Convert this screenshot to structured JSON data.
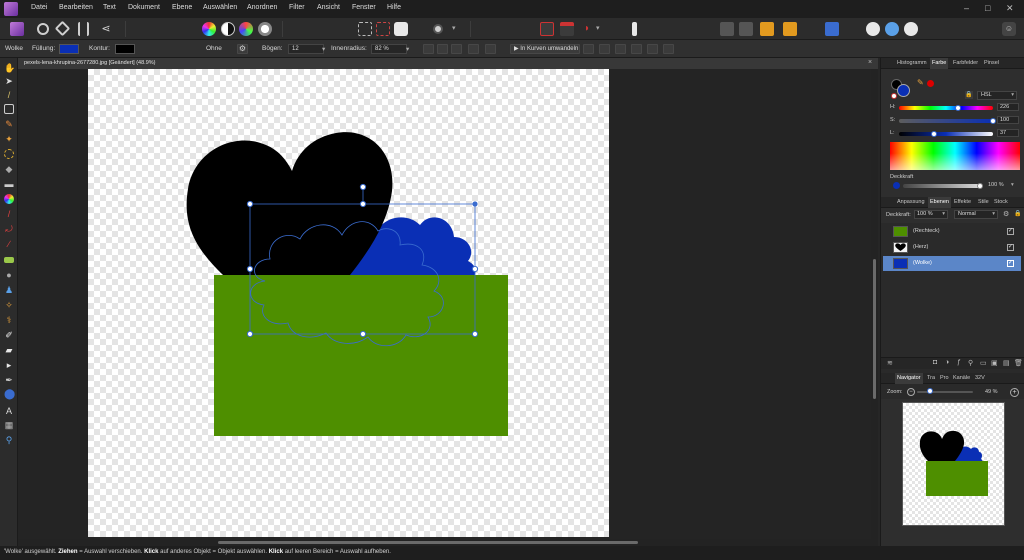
{
  "menubar": {
    "items": [
      "Datei",
      "Bearbeiten",
      "Text",
      "Dokument",
      "Ebene",
      "Auswählen",
      "Anordnen",
      "Filter",
      "Ansicht",
      "Fenster",
      "Hilfe"
    ]
  },
  "context": {
    "tool_name": "Wolke",
    "fill_label": "Füllung:",
    "stroke_label": "Kontur:",
    "stroke_value": "Ohne",
    "arcs_label": "Bögen:",
    "arcs_value": "12",
    "inner_radius_label": "Innenradius:",
    "inner_radius_value": "82 %",
    "convert_curves_label": "In Kurven umwandeln",
    "fill_color": "#0a2fb5",
    "stroke_color": "#000000"
  },
  "document": {
    "tab_title": "pexels-lena-khrupina-2677280.jpg [Geändert] (48.9%)"
  },
  "colors": {
    "heart": "#000000",
    "cloud": "#0a2fb5",
    "rectangle": "#4e8f00",
    "selection": "#3a6ccf"
  },
  "panels": {
    "top_tabs": [
      "Histogramm",
      "Farbe",
      "Farbfelder",
      "Pinsel"
    ],
    "top_active": "Farbe",
    "color_model": "HSL",
    "hue": {
      "label": "H:",
      "value": "226",
      "fraction": 0.628
    },
    "saturation": {
      "label": "S:",
      "value": "100",
      "fraction": 1.0
    },
    "lightness": {
      "label": "L:",
      "value": "37",
      "fraction": 0.37
    },
    "opacity": {
      "label": "Deckkraft",
      "value": "100 %"
    },
    "mid_tabs": [
      "Anpassung",
      "Ebenen",
      "Effekte",
      "Stile",
      "Stock"
    ],
    "mid_active": "Ebenen",
    "layer_opacity_label": "Deckkraft:",
    "layer_opacity_value": "100 %",
    "blend_mode": "Normal",
    "layers": [
      {
        "name": "(Rechteck)",
        "checked": "✓",
        "color": "#4e8f00"
      },
      {
        "name": "(Herz)",
        "checked": "✓",
        "color": "#000000"
      },
      {
        "name": "(Wolke)",
        "checked": "✓",
        "color": "#0a2fb5"
      }
    ],
    "nav_tabs": [
      "Navigator",
      "Tra",
      "Pro",
      "Kanäle",
      "32V"
    ],
    "nav_active": "Navigator",
    "zoom_label": "Zoom:",
    "zoom_value": "49 %"
  },
  "status": {
    "text_part1": "'Wolke' ausgewählt. ",
    "bold1": "Ziehen",
    "text_part2": " = Auswahl verschieben. ",
    "bold2": "Klick",
    "text_part3": " auf anderes Objekt = Objekt auswählen. ",
    "bold3": "Klick",
    "text_part4": " auf leeren Bereich = Auswahl aufheben."
  }
}
